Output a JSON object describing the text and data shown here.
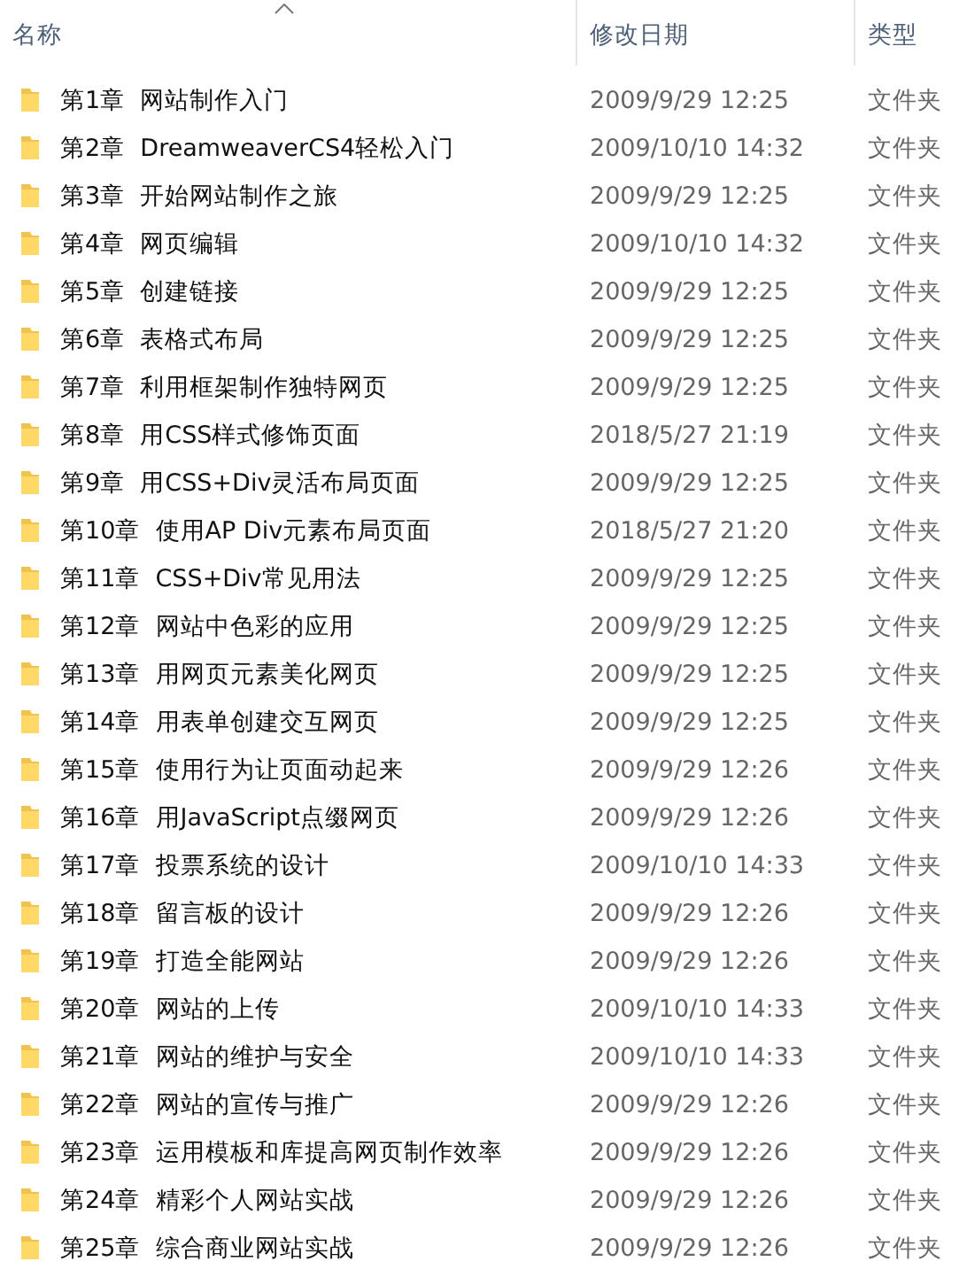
{
  "columns": [
    {
      "label": "名称",
      "sorted": true
    },
    {
      "label": "修改日期",
      "sorted": false
    },
    {
      "label": "类型",
      "sorted": false
    }
  ],
  "rows": [
    {
      "name": "第1章  网站制作入门",
      "date": "2009/9/29 12:25",
      "type": "文件夹"
    },
    {
      "name": "第2章  DreamweaverCS4轻松入门",
      "date": "2009/10/10 14:32",
      "type": "文件夹"
    },
    {
      "name": "第3章  开始网站制作之旅",
      "date": "2009/9/29 12:25",
      "type": "文件夹"
    },
    {
      "name": "第4章  网页编辑",
      "date": "2009/10/10 14:32",
      "type": "文件夹"
    },
    {
      "name": "第5章  创建链接",
      "date": "2009/9/29 12:25",
      "type": "文件夹"
    },
    {
      "name": "第6章  表格式布局",
      "date": "2009/9/29 12:25",
      "type": "文件夹"
    },
    {
      "name": "第7章  利用框架制作独特网页",
      "date": "2009/9/29 12:25",
      "type": "文件夹"
    },
    {
      "name": "第8章  用CSS样式修饰页面",
      "date": "2018/5/27 21:19",
      "type": "文件夹"
    },
    {
      "name": "第9章  用CSS+Div灵活布局页面",
      "date": "2009/9/29 12:25",
      "type": "文件夹"
    },
    {
      "name": "第10章  使用AP Div元素布局页面",
      "date": "2018/5/27 21:20",
      "type": "文件夹"
    },
    {
      "name": "第11章  CSS+Div常见用法",
      "date": "2009/9/29 12:25",
      "type": "文件夹"
    },
    {
      "name": "第12章  网站中色彩的应用",
      "date": "2009/9/29 12:25",
      "type": "文件夹"
    },
    {
      "name": "第13章  用网页元素美化网页",
      "date": "2009/9/29 12:25",
      "type": "文件夹"
    },
    {
      "name": "第14章  用表单创建交互网页",
      "date": "2009/9/29 12:25",
      "type": "文件夹"
    },
    {
      "name": "第15章  使用行为让页面动起来",
      "date": "2009/9/29 12:26",
      "type": "文件夹"
    },
    {
      "name": "第16章  用JavaScript点缀网页",
      "date": "2009/9/29 12:26",
      "type": "文件夹"
    },
    {
      "name": "第17章  投票系统的设计",
      "date": "2009/10/10 14:33",
      "type": "文件夹"
    },
    {
      "name": "第18章  留言板的设计",
      "date": "2009/9/29 12:26",
      "type": "文件夹"
    },
    {
      "name": "第19章  打造全能网站",
      "date": "2009/9/29 12:26",
      "type": "文件夹"
    },
    {
      "name": "第20章  网站的上传",
      "date": "2009/10/10 14:33",
      "type": "文件夹"
    },
    {
      "name": "第21章  网站的维护与安全",
      "date": "2009/10/10 14:33",
      "type": "文件夹"
    },
    {
      "name": "第22章  网站的宣传与推广",
      "date": "2009/9/29 12:26",
      "type": "文件夹"
    },
    {
      "name": "第23章  运用模板和库提高网页制作效率",
      "date": "2009/9/29 12:26",
      "type": "文件夹"
    },
    {
      "name": "第24章  精彩个人网站实战",
      "date": "2009/9/29 12:26",
      "type": "文件夹"
    },
    {
      "name": "第25章  综合商业网站实战",
      "date": "2009/9/29 12:26",
      "type": "文件夹"
    }
  ]
}
